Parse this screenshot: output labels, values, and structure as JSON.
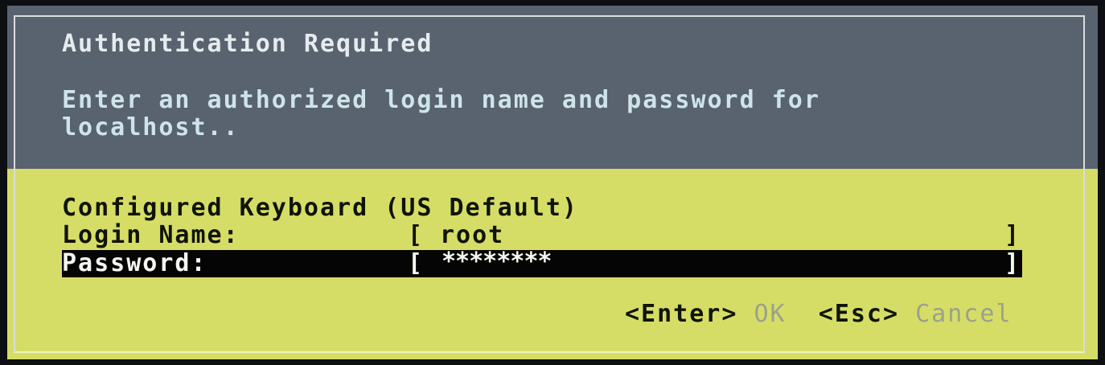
{
  "dialog": {
    "title": "Authentication Required",
    "message_line1": "Enter an authorized login name and password for",
    "message_line2": "localhost.."
  },
  "form": {
    "keyboard_text": "Configured Keyboard (US Default)",
    "login_label": "Login Name:",
    "login_value": "root",
    "password_label": "Password:",
    "password_value": "********",
    "bracket_open": "[",
    "bracket_close": "]"
  },
  "actions": {
    "enter_key": "<Enter>",
    "ok_label": "OK",
    "esc_key": "<Esc>",
    "cancel_label": "Cancel"
  },
  "colors": {
    "header_background": "#58636f",
    "body_background": "#d6dd66",
    "selected_row_background": "#050505",
    "disabled_text": "#9aa18c"
  }
}
